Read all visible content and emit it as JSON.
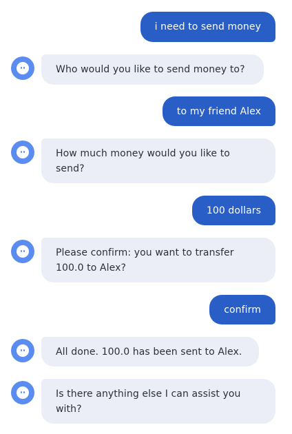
{
  "messages": [
    {
      "from": "user",
      "text": "i need to send money"
    },
    {
      "from": "bot",
      "text": "Who would you like to send money to?"
    },
    {
      "from": "user",
      "text": "to my friend Alex"
    },
    {
      "from": "bot",
      "text": "How much money would you like to send?"
    },
    {
      "from": "user",
      "text": "100 dollars"
    },
    {
      "from": "bot",
      "text": "Please confirm: you want to transfer 100.0 to Alex?"
    },
    {
      "from": "user",
      "text": "confirm"
    },
    {
      "from": "bot",
      "text": "All done. 100.0 has been sent to Alex."
    },
    {
      "from": "bot",
      "text": "Is there anything else I can assist you with?"
    }
  ],
  "colors": {
    "user_bubble": "#2a5ec7",
    "bot_bubble": "#eceef7",
    "avatar": "#5b8cf0",
    "bot_text": "#2b2f3a"
  },
  "icons": {
    "bot_avatar": "bot-avatar-icon"
  }
}
